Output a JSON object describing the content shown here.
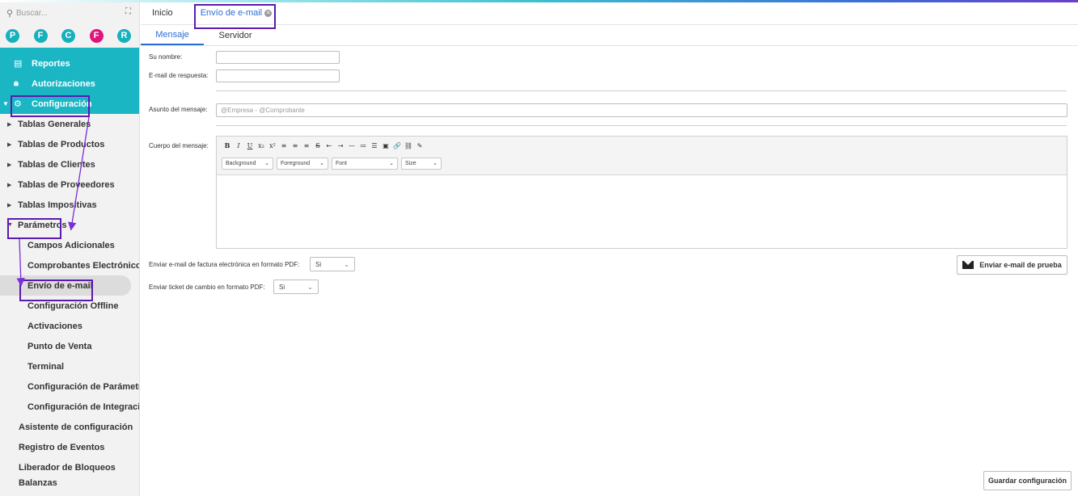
{
  "sidebar": {
    "search_placeholder": "Buscar...",
    "avatars": [
      {
        "letter": "P",
        "color": "#17b1bd"
      },
      {
        "letter": "F",
        "color": "#17b1bd"
      },
      {
        "letter": "C",
        "color": "#17b1bd"
      },
      {
        "letter": "F",
        "color": "#e0147b"
      },
      {
        "letter": "R",
        "color": "#17b1bd"
      }
    ],
    "teal_items": [
      "Reportes",
      "Autorizaciones",
      "Configuración"
    ],
    "groups": [
      "Tablas Generales",
      "Tablas de Productos",
      "Tablas de Clientes",
      "Tablas de Proveedores",
      "Tablas Impositivas",
      "Parámetros"
    ],
    "param_children": [
      "Campos Adicionales",
      "Comprobantes Electrónicos",
      "Envío de e-mail",
      "Configuración Offline",
      "Activaciones",
      "Punto de Venta",
      "Terminal",
      "Configuración de Parámetros",
      "Configuración de Integraciones"
    ],
    "root_items": [
      "Asistente de configuración",
      "Registro de Eventos",
      "Liberador de Bloqueos",
      "Balanzas"
    ]
  },
  "tabs": {
    "home": "Inicio",
    "email": "Envío de e-mail"
  },
  "subtabs": {
    "message": "Mensaje",
    "server": "Servidor"
  },
  "form": {
    "name_label": "Su nombre:",
    "name_value": "",
    "reply_label": "E-mail de respuesta:",
    "reply_value": "",
    "subject_label": "Asunto del mensaje:",
    "subject_value": "@Empresa - @Comprobante",
    "body_label": "Cuerpo del mensaje:",
    "editor_buttons": [
      "B",
      "I",
      "U",
      "x₂",
      "x²",
      "≡",
      "≡",
      "≡",
      "S",
      "⇤",
      "⇥",
      "—",
      "≔",
      "☰",
      "▣",
      "🔗",
      "⛓",
      "✎"
    ],
    "editor_selects": [
      "Background",
      "Foreground",
      "Font",
      "Size"
    ],
    "pdf_label": "Enviar e-mail de factura electrónica en formato PDF:",
    "pdf_value": "Si",
    "ticket_label": "Enviar ticket de cambio en formato PDF:",
    "ticket_value": "Si",
    "test_button": "Enviar e-mail de prueba",
    "save_button": "Guardar configuración"
  },
  "colors": {
    "teal": "#1bb6c4",
    "annotation": "#5b1ab0",
    "active_blue": "#2b6fd6"
  }
}
